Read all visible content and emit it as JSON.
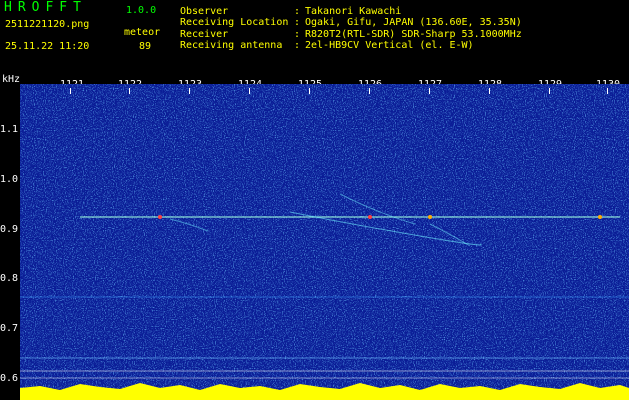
{
  "header": {
    "app_name": "HROFFT",
    "version": "1.0.0",
    "filename": "2511221120.png",
    "datetime": "25.11.22 11:20",
    "category": "meteor",
    "count": "89",
    "info": [
      {
        "label": "Observer",
        "value": "Takanori Kawachi"
      },
      {
        "label": "Receiving Location",
        "value": "Ogaki, Gifu, JAPAN (136.60E, 35.35N)"
      },
      {
        "label": "Receiver",
        "value": "R820T2(RTL-SDR) SDR-Sharp 53.1000MHz"
      },
      {
        "label": "Receiving antenna",
        "value": "2el-HB9CV Vertical (el. E-W)"
      }
    ]
  },
  "axis": {
    "unit": "kHz",
    "x_ticks": [
      "1121",
      "1122",
      "1123",
      "1124",
      "1125",
      "1126",
      "1127",
      "1128",
      "1129",
      "1130"
    ],
    "y_ticks": [
      "1.1",
      "1.0",
      "0.9",
      "0.8",
      "0.7",
      "0.6"
    ]
  },
  "colors": {
    "background": "#000000",
    "header_text": "#ffff00",
    "app_title": "#00ff00",
    "spectrum_base": "#0b1f9e",
    "carrier_line": "#a0ffe0",
    "noise_floor": "#ffff00"
  }
}
